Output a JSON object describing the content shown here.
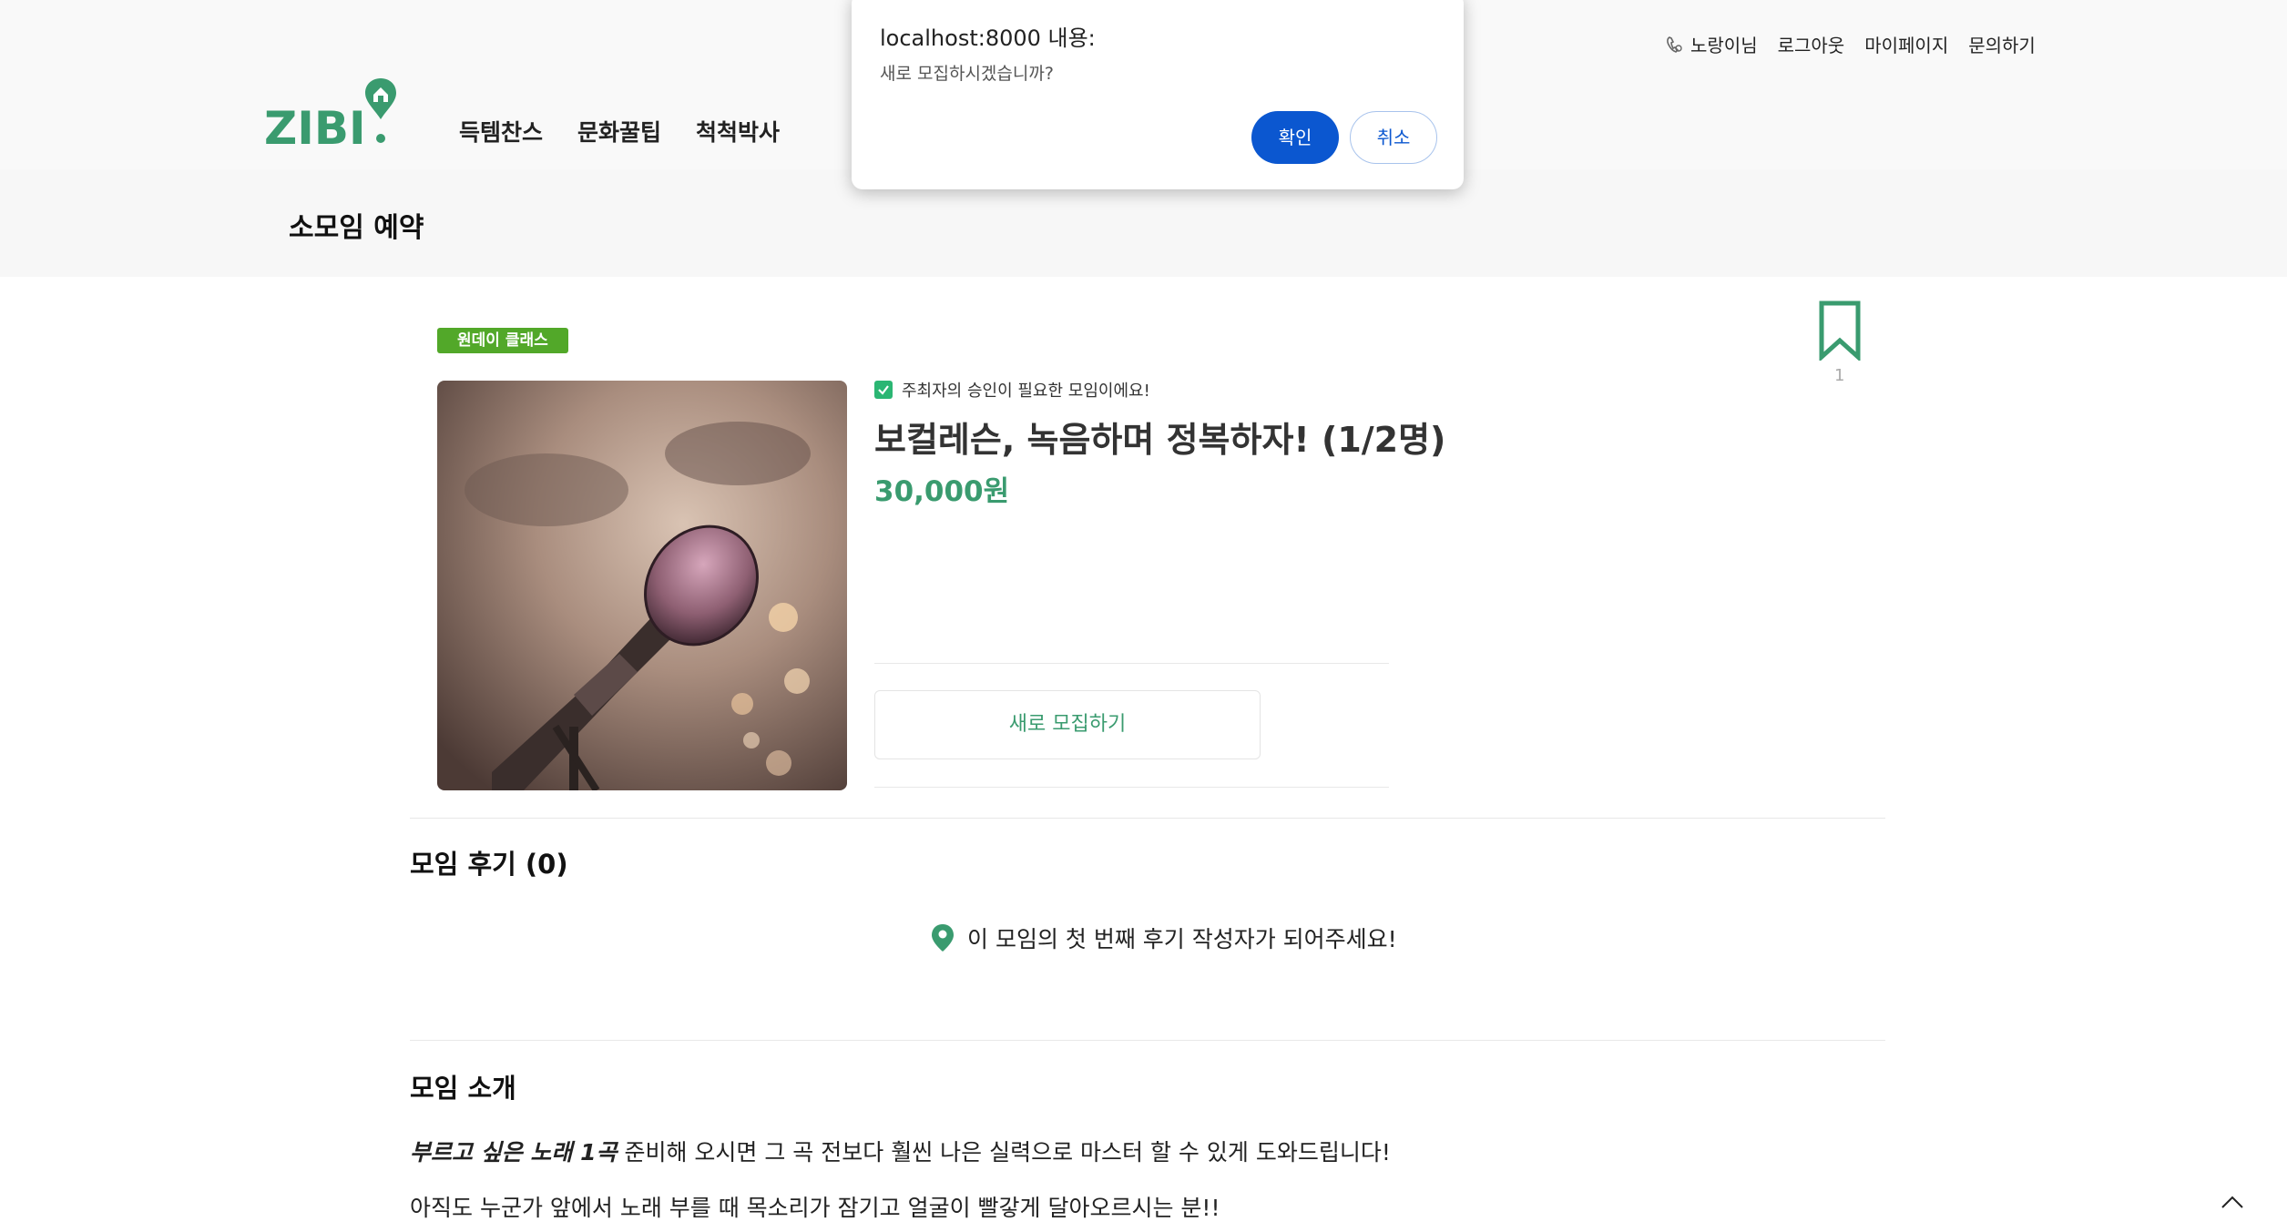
{
  "header": {
    "logo_text": "ZIBI",
    "utility_nav": {
      "username": "노랑이님",
      "logout": "로그아웃",
      "mypage": "마이페이지",
      "inquiry": "문의하기"
    },
    "main_nav": [
      {
        "label": "득템찬스"
      },
      {
        "label": "문화꿀팁"
      },
      {
        "label": "척척박사"
      }
    ],
    "page_title": "소모임 예약"
  },
  "meetup": {
    "category": "원데이 클래스",
    "approval_note": "주최자의 승인이 필요한 모임이에요!",
    "title": "보컬레슨, 녹음하며 정복하자! (1/2명)",
    "price": "30,000원",
    "bookmark_count": "1",
    "recruit_button": "새로 모집하기"
  },
  "reviews": {
    "heading": "모임 후기 (0)",
    "empty_message": "이 모임의 첫 번째 후기 작성자가 되어주세요!"
  },
  "intro": {
    "heading": "모임 소개",
    "line1_emphasis": "부르고 싶은 노래 1곡",
    "line1_rest": " 준비해 오시면 그 곡 전보다 훨씬 나은 실력으로 마스터 할 수 있게 도와드립니다!",
    "line2": "아직도 누군가 앞에서 노래 부를 때 목소리가 잠기고 얼굴이 빨갛게 달아오르시는 분!!"
  },
  "dialog": {
    "title": "localhost:8000 내용:",
    "message": "새로 모집하시겠습니까?",
    "ok": "확인",
    "cancel": "취소"
  },
  "colors": {
    "brand_green": "#3a9b6f",
    "badge_green": "#52a829",
    "dialog_blue": "#0b57d0"
  }
}
